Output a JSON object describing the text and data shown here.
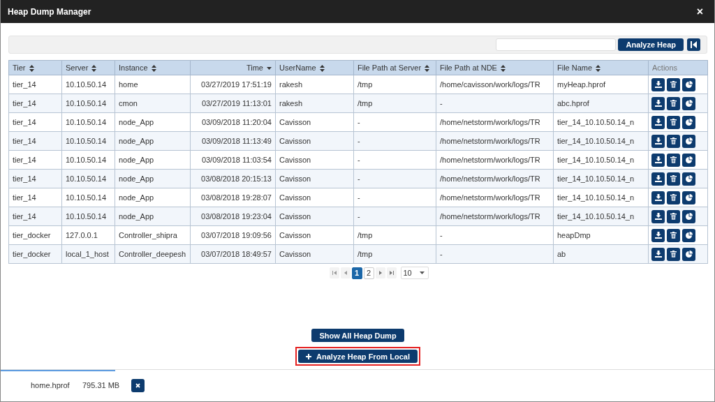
{
  "window": {
    "title": "Heap Dump Manager",
    "close_label": "×"
  },
  "toolbar": {
    "analyze_button": "Analyze Heap"
  },
  "table": {
    "columns": [
      {
        "label": "Tier",
        "sortable": true,
        "sorted": false
      },
      {
        "label": "Server",
        "sortable": true,
        "sorted": false
      },
      {
        "label": "Instance",
        "sortable": true,
        "sorted": false
      },
      {
        "label": "Time",
        "sortable": true,
        "sorted": true
      },
      {
        "label": "UserName",
        "sortable": true,
        "sorted": false
      },
      {
        "label": "File Path at Server",
        "sortable": true,
        "sorted": false
      },
      {
        "label": "File Path at NDE",
        "sortable": true,
        "sorted": false
      },
      {
        "label": "File Name",
        "sortable": true,
        "sorted": false
      },
      {
        "label": "Actions",
        "sortable": false,
        "sorted": false
      }
    ],
    "rows": [
      {
        "cells": [
          "tier_14",
          "10.10.50.14",
          "home",
          "03/27/2019 17:51:19",
          "rakesh",
          "/tmp",
          "/home/cavisson/work/logs/TR",
          "myHeap.hprof"
        ]
      },
      {
        "cells": [
          "tier_14",
          "10.10.50.14",
          "cmon",
          "03/27/2019 11:13:01",
          "rakesh",
          "/tmp",
          "-",
          "abc.hprof"
        ]
      },
      {
        "cells": [
          "tier_14",
          "10.10.50.14",
          "node_App",
          "03/09/2018 11:20:04",
          "Cavisson",
          "-",
          "/home/netstorm/work/logs/TR",
          "tier_14_10.10.50.14_n"
        ]
      },
      {
        "cells": [
          "tier_14",
          "10.10.50.14",
          "node_App",
          "03/09/2018 11:13:49",
          "Cavisson",
          "-",
          "/home/netstorm/work/logs/TR",
          "tier_14_10.10.50.14_n"
        ]
      },
      {
        "cells": [
          "tier_14",
          "10.10.50.14",
          "node_App",
          "03/09/2018 11:03:54",
          "Cavisson",
          "-",
          "/home/netstorm/work/logs/TR",
          "tier_14_10.10.50.14_n"
        ]
      },
      {
        "cells": [
          "tier_14",
          "10.10.50.14",
          "node_App",
          "03/08/2018 20:15:13",
          "Cavisson",
          "-",
          "/home/netstorm/work/logs/TR",
          "tier_14_10.10.50.14_n"
        ]
      },
      {
        "cells": [
          "tier_14",
          "10.10.50.14",
          "node_App",
          "03/08/2018 19:28:07",
          "Cavisson",
          "-",
          "/home/netstorm/work/logs/TR",
          "tier_14_10.10.50.14_n"
        ]
      },
      {
        "cells": [
          "tier_14",
          "10.10.50.14",
          "node_App",
          "03/08/2018 19:23:04",
          "Cavisson",
          "-",
          "/home/netstorm/work/logs/TR",
          "tier_14_10.10.50.14_n"
        ]
      },
      {
        "cells": [
          "tier_docker",
          "127.0.0.1",
          "Controller_shipra",
          "03/07/2018 19:09:56",
          "Cavisson",
          "/tmp",
          "-",
          "heapDmp"
        ]
      },
      {
        "cells": [
          "tier_docker",
          "local_1_host",
          "Controller_deepesh",
          "03/07/2018 18:49:57",
          "Cavisson",
          "/tmp",
          "-",
          "ab"
        ]
      }
    ]
  },
  "paginator": {
    "pages": [
      {
        "label": "1",
        "selected": true
      },
      {
        "label": "2",
        "selected": false
      }
    ],
    "page_size": "10"
  },
  "buttons": [
    {
      "label": "Show All Heap Dump",
      "highlighted": false
    },
    {
      "label": "Analyze Heap From Local",
      "highlighted": true
    }
  ],
  "upload": {
    "level": 0.16,
    "file_name": "home.hprof",
    "size": "795.31 MB"
  }
}
